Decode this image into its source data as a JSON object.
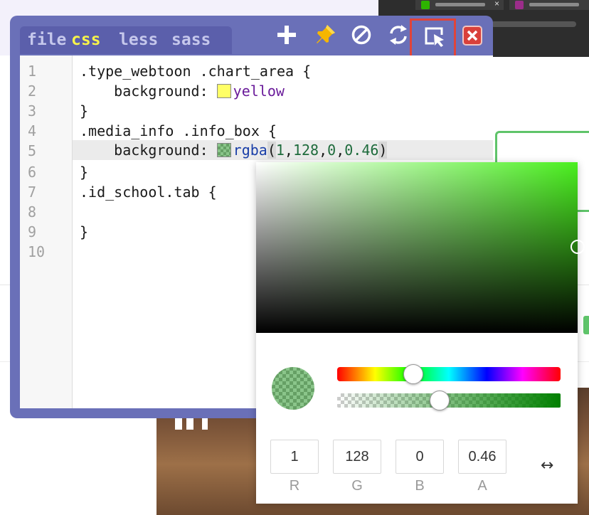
{
  "colors": {
    "editor_bg": "#6a70b8",
    "tab_active": "#f8f44a",
    "tab_inactive": "#c6c8ec",
    "highlight_outline": "#e0443a",
    "hue_value": "#4af01f",
    "yellow_swatch": "#ffff66"
  },
  "editor": {
    "tabs": [
      {
        "label": "file",
        "active": false
      },
      {
        "label": "css",
        "active": true
      },
      {
        "label": "less",
        "active": false
      },
      {
        "label": "sass",
        "active": false
      }
    ],
    "toolbar": [
      "plus-icon",
      "pin-icon",
      "disable-icon",
      "refresh-icon",
      "select-element-icon",
      "close-icon"
    ],
    "line_numbers": [
      "1",
      "2",
      "3",
      "4",
      "5",
      "6",
      "7",
      "8",
      "9",
      "10"
    ],
    "lines": {
      "l1": ".type_webtoon .chart_area {",
      "l2_prop": "    background: ",
      "l2_val": "yellow",
      "l3": "}",
      "l4": ".media_info .info_box {",
      "l5_prop": "    background: ",
      "l5_fn": "rgba",
      "l5_open": "(",
      "l5_r": "1",
      "l5_g": "128",
      "l5_b": "0",
      "l5_a": "0.46",
      "l5_comma": ",",
      "l5_close": ")",
      "l6": "}",
      "l7": ".id_school.tab {",
      "l9": "}"
    }
  },
  "picker": {
    "hue_fraction": 0.34,
    "alpha_fraction": 0.46,
    "channels": [
      {
        "label": "R",
        "value": "1"
      },
      {
        "label": "G",
        "value": "128"
      },
      {
        "label": "B",
        "value": "0"
      },
      {
        "label": "A",
        "value": "0.46"
      }
    ],
    "swap_glyph": "↔"
  }
}
